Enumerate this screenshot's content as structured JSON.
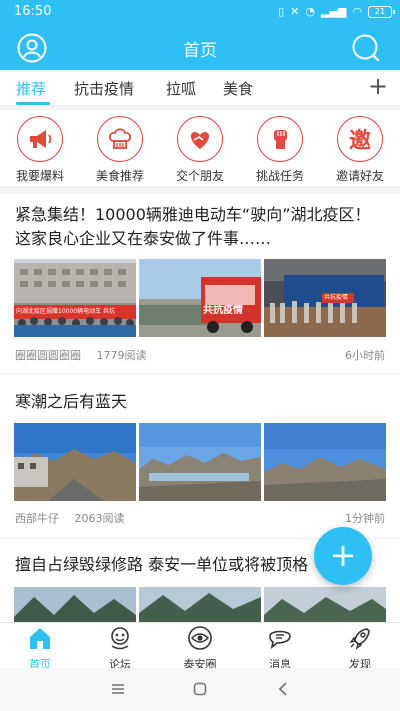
{
  "status_bar": {
    "time": "16:50",
    "icons": [
      "sim-icon",
      "mute-icon",
      "alarm-icon",
      "signal-icon",
      "wifi-icon",
      "battery-icon"
    ],
    "battery": "21"
  },
  "header": {
    "title": "首页",
    "bg_color": "#2ec0f4"
  },
  "tabs": [
    {
      "label": "推荐",
      "active": true
    },
    {
      "label": "抗击疫情",
      "active": false
    },
    {
      "label": "拉呱",
      "active": false
    },
    {
      "label": "美食",
      "active": false
    }
  ],
  "quick_actions": [
    {
      "label": "我要爆料",
      "icon": "megaphone-icon"
    },
    {
      "label": "美食推荐",
      "icon": "chef-hat-icon"
    },
    {
      "label": "交个朋友",
      "icon": "handshake-heart-icon"
    },
    {
      "label": "挑战任务",
      "icon": "fist-icon"
    },
    {
      "label": "邀请好友",
      "icon": "invite-icon",
      "glyph": "邀"
    }
  ],
  "articles": [
    {
      "title": "紧急集结！10000辆雅迪电动车“驶向”湖北疫区！这家良心企业又在泰安做了件事……",
      "source": "圈圈圆圆圈圈",
      "reads": "1779阅读",
      "time": "6小时前",
      "image_captions": [
        "向湖北疫区捐赠10000辆电动车 共抗",
        "共抗疫情",
        "共抗疫情"
      ]
    },
    {
      "title": "寒潮之后有蓝天",
      "source": "西部牛仔",
      "reads": "2063阅读",
      "time": "1分钟前"
    },
    {
      "title": "擅自占绿毁绿修路 泰安一单位或将被顶格"
    }
  ],
  "fab": {
    "label": "+"
  },
  "bottom_nav": [
    {
      "label": "首页",
      "icon": "home-icon",
      "active": true
    },
    {
      "label": "论坛",
      "icon": "forum-icon",
      "active": false
    },
    {
      "label": "泰安圈",
      "icon": "eye-icon",
      "active": false
    },
    {
      "label": "消息",
      "icon": "message-icon",
      "active": false
    },
    {
      "label": "发现",
      "icon": "rocket-icon",
      "active": false
    }
  ],
  "accent_color": "#2ec0f4",
  "quick_action_color": "#e04a3f"
}
